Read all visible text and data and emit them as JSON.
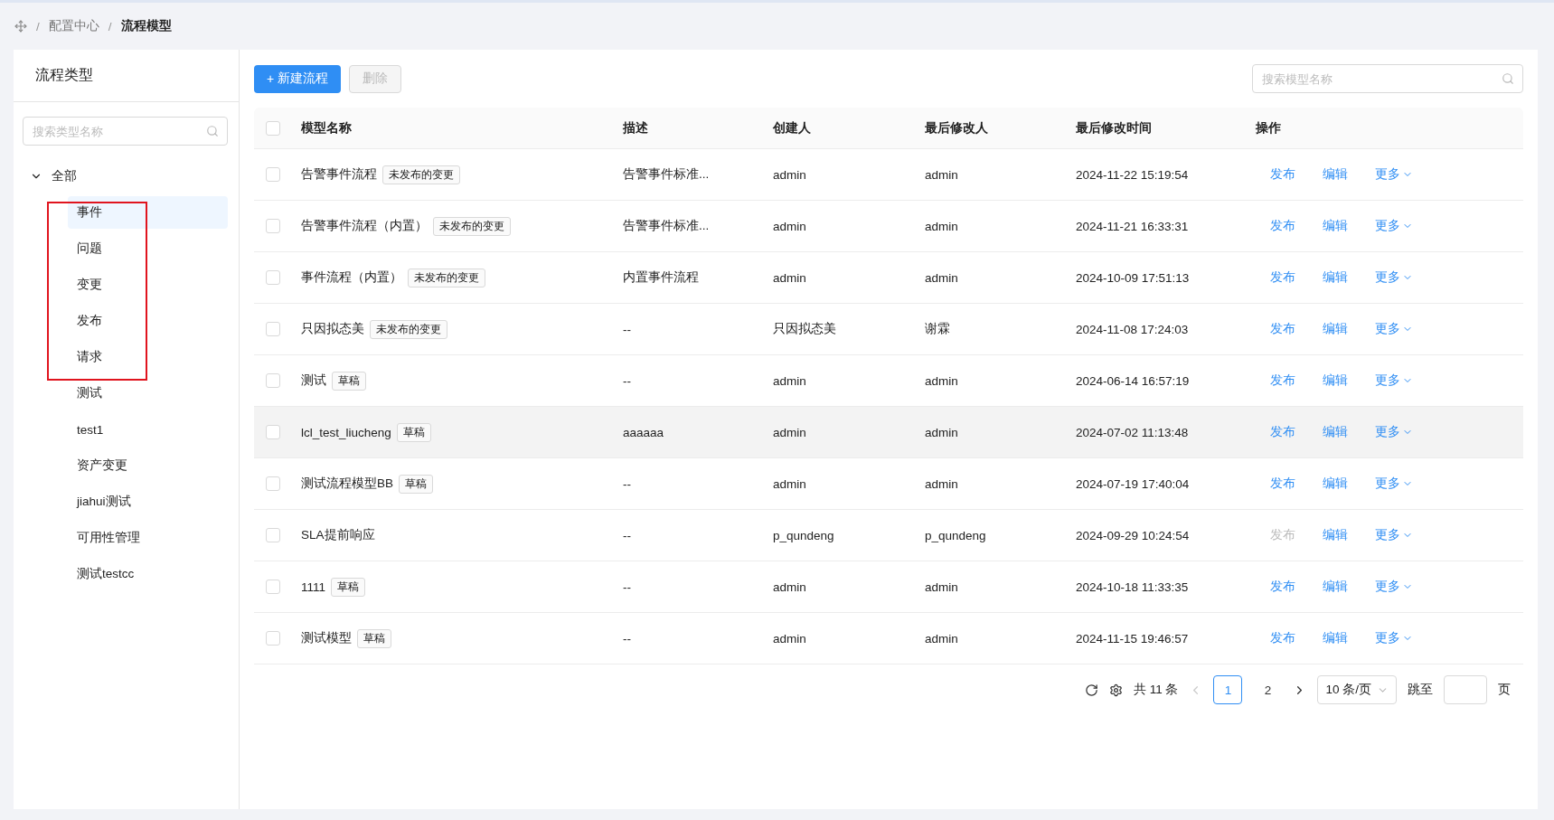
{
  "breadcrumb": {
    "separator": "/",
    "items": [
      "配置中心",
      "流程模型"
    ]
  },
  "sidebar": {
    "title": "流程类型",
    "search": {
      "placeholder": "搜索类型名称"
    },
    "tree": [
      {
        "label": "全部",
        "expanded": true,
        "selected": false,
        "children": [
          {
            "label": "事件",
            "selected": true
          },
          {
            "label": "问题",
            "selected": false
          },
          {
            "label": "变更",
            "selected": false
          },
          {
            "label": "发布",
            "selected": false
          },
          {
            "label": "请求",
            "selected": false
          },
          {
            "label": "测试",
            "selected": false
          },
          {
            "label": "test1",
            "selected": false
          },
          {
            "label": "资产变更",
            "selected": false
          },
          {
            "label": "jiahui测试",
            "selected": false
          },
          {
            "label": "可用性管理",
            "selected": false
          },
          {
            "label": "测试testcc",
            "selected": false
          }
        ]
      }
    ]
  },
  "toolbar": {
    "new_button": {
      "icon": "+",
      "label": "新建流程"
    },
    "delete_button": {
      "label": "删除",
      "disabled": true
    },
    "search": {
      "placeholder": "搜索模型名称"
    }
  },
  "table": {
    "columns": [
      "模型名称",
      "描述",
      "创建人",
      "最后修改人",
      "最后修改时间",
      "操作"
    ],
    "select_all_checked": false,
    "rows": [
      {
        "name": "告警事件流程",
        "tag": "未发布的变更",
        "description": "告警事件标准...",
        "creator": "admin",
        "modifier": "admin",
        "time": "2024-11-22 15:19:54",
        "checked": false,
        "hovered": false,
        "actions": [
          {
            "label": "发布",
            "disabled": false
          },
          {
            "label": "编辑",
            "disabled": false
          }
        ],
        "more": "更多"
      },
      {
        "name": "告警事件流程（内置）",
        "tag": "未发布的变更",
        "description": "告警事件标准...",
        "creator": "admin",
        "modifier": "admin",
        "time": "2024-11-21 16:33:31",
        "checked": false,
        "hovered": false,
        "actions": [
          {
            "label": "发布",
            "disabled": false
          },
          {
            "label": "编辑",
            "disabled": false
          }
        ],
        "more": "更多"
      },
      {
        "name": "事件流程（内置）",
        "tag": "未发布的变更",
        "description": "内置事件流程",
        "creator": "admin",
        "modifier": "admin",
        "time": "2024-10-09 17:51:13",
        "checked": false,
        "hovered": false,
        "actions": [
          {
            "label": "发布",
            "disabled": false
          },
          {
            "label": "编辑",
            "disabled": false
          }
        ],
        "more": "更多"
      },
      {
        "name": "只因拟态美",
        "tag": "未发布的变更",
        "description": "--",
        "creator": "只因拟态美",
        "modifier": "谢霖",
        "time": "2024-11-08 17:24:03",
        "checked": false,
        "hovered": false,
        "actions": [
          {
            "label": "发布",
            "disabled": false
          },
          {
            "label": "编辑",
            "disabled": false
          }
        ],
        "more": "更多"
      },
      {
        "name": "测试",
        "tag": "草稿",
        "description": "--",
        "creator": "admin",
        "modifier": "admin",
        "time": "2024-06-14 16:57:19",
        "checked": false,
        "hovered": false,
        "actions": [
          {
            "label": "发布",
            "disabled": false
          },
          {
            "label": "编辑",
            "disabled": false
          }
        ],
        "more": "更多"
      },
      {
        "name": "lcl_test_liucheng",
        "tag": "草稿",
        "description": "aaaaaa",
        "creator": "admin",
        "modifier": "admin",
        "time": "2024-07-02 11:13:48",
        "checked": false,
        "hovered": true,
        "actions": [
          {
            "label": "发布",
            "disabled": false
          },
          {
            "label": "编辑",
            "disabled": false
          }
        ],
        "more": "更多"
      },
      {
        "name": "测试流程模型BB",
        "tag": "草稿",
        "description": "--",
        "creator": "admin",
        "modifier": "admin",
        "time": "2024-07-19 17:40:04",
        "checked": false,
        "hovered": false,
        "actions": [
          {
            "label": "发布",
            "disabled": false
          },
          {
            "label": "编辑",
            "disabled": false
          }
        ],
        "more": "更多"
      },
      {
        "name": "SLA提前响应",
        "description": "--",
        "creator": "p_qundeng",
        "modifier": "p_qundeng",
        "time": "2024-09-29 10:24:54",
        "checked": false,
        "hovered": false,
        "actions": [
          {
            "label": "发布",
            "disabled": true
          },
          {
            "label": "编辑",
            "disabled": false
          }
        ],
        "more": "更多"
      },
      {
        "name": "1111",
        "tag": "草稿",
        "description": "--",
        "creator": "admin",
        "modifier": "admin",
        "time": "2024-10-18 11:33:35",
        "checked": false,
        "hovered": false,
        "actions": [
          {
            "label": "发布",
            "disabled": false
          },
          {
            "label": "编辑",
            "disabled": false
          }
        ],
        "more": "更多"
      },
      {
        "name": "测试模型",
        "tag": "草稿",
        "description": "--",
        "creator": "admin",
        "modifier": "admin",
        "time": "2024-11-15 19:46:57",
        "checked": false,
        "hovered": false,
        "actions": [
          {
            "label": "发布",
            "disabled": false
          },
          {
            "label": "编辑",
            "disabled": false
          }
        ],
        "more": "更多"
      }
    ]
  },
  "pagination": {
    "total": "共 11 条",
    "pages": [
      {
        "label": "1",
        "selected": true
      },
      {
        "label": "2",
        "selected": false
      }
    ],
    "page_size": "10 条/页",
    "jump_label": "跳至",
    "page_unit": "页"
  }
}
